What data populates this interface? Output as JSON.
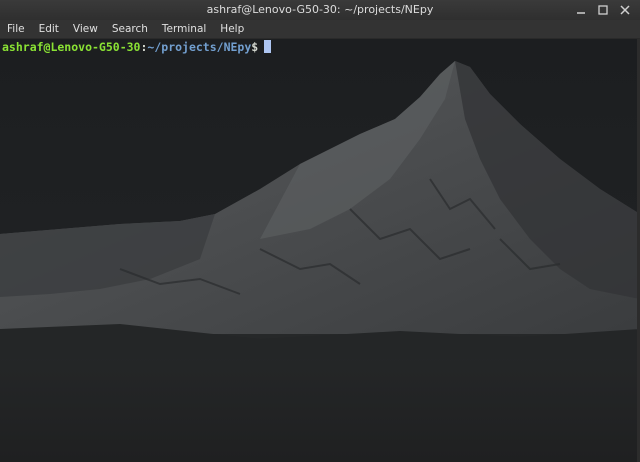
{
  "window": {
    "title": "ashraf@Lenovo-G50-30: ~/projects/NEpy",
    "controls": [
      "minimize-icon",
      "maximize-icon",
      "close-icon"
    ]
  },
  "menu": {
    "items": [
      "File",
      "Edit",
      "View",
      "Search",
      "Terminal",
      "Help"
    ]
  },
  "terminal": {
    "prompt_user_host": "ashraf@Lenovo-G50-30",
    "prompt_separator": ":",
    "prompt_path": "~/projects/NEpy",
    "prompt_symbol": "$",
    "colors": {
      "user_host": "#8ae234",
      "path": "#729fcf",
      "cursor": "#aec6f2"
    }
  }
}
